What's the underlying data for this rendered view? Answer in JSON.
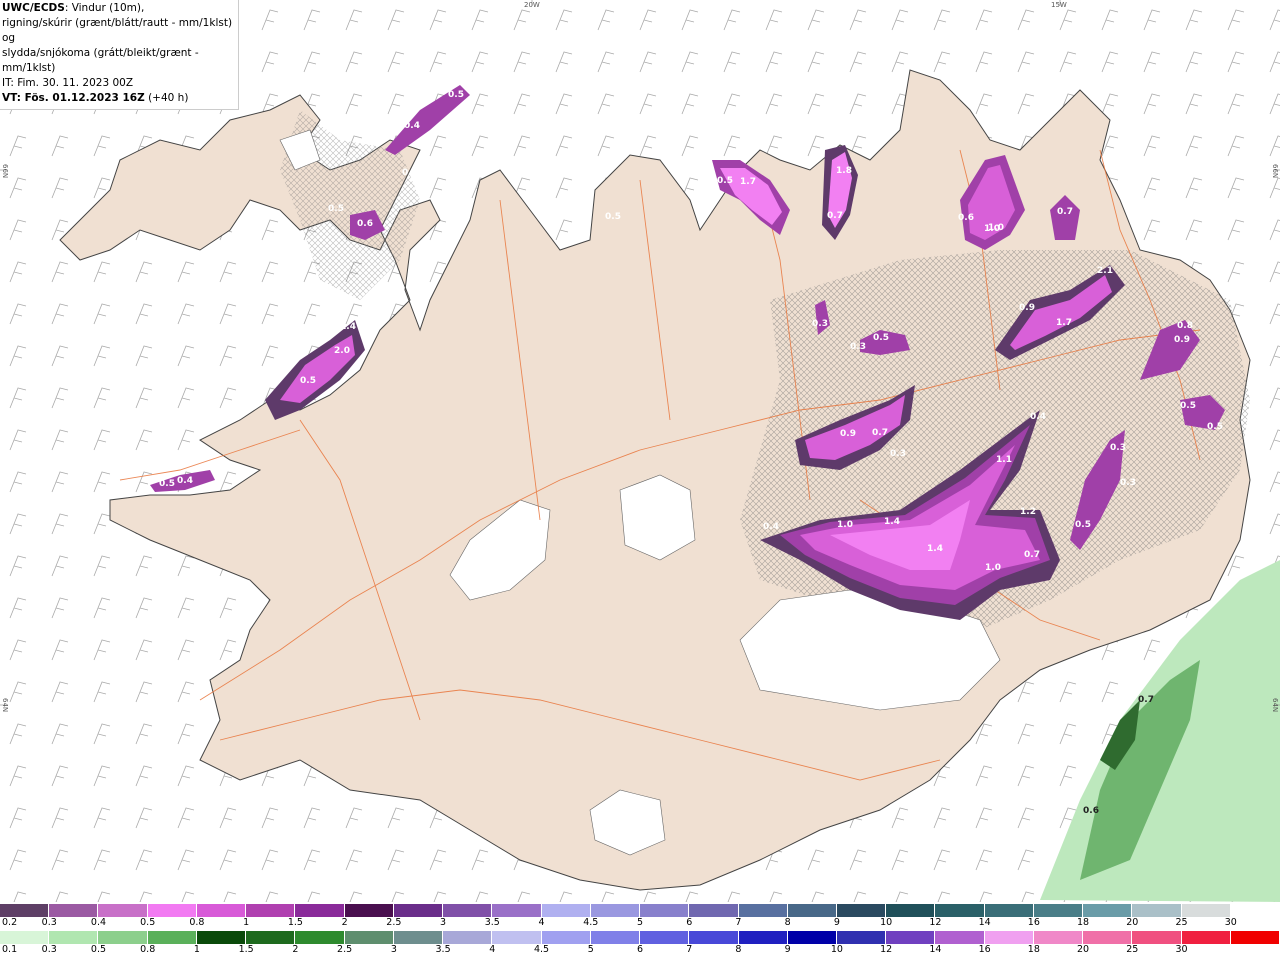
{
  "header": {
    "title": "UWC/ECDS",
    "description_line1": ": Vindur (10m),",
    "description_line2": "rigning/skúrir (grænt/blátt/rautt - mm/1klst) og",
    "description_line3": "slydda/snjókoma (grátt/bleikt/grænt - mm/1klst)",
    "init_time": "IT: Fim. 30. 11. 2023 00Z",
    "valid_label": "VT: Fös. 01.12.2023 16Z",
    "valid_offset": " (+40 h)"
  },
  "coords": {
    "lon_20w": "20W",
    "lon_15w": "15W",
    "lat_66n_left": "66N",
    "lat_66n_right": "66N",
    "lat_64n_left": "64N",
    "lat_64n_right": "64N"
  },
  "colors": {
    "land": "#f0e0d2",
    "glacier": "#ffffff",
    "roads": "#e8743a",
    "coast": "#444444",
    "snow_light": "#f280f2",
    "snow_mid": "#d860d8",
    "snow_dark": "#a040a8",
    "snow_darkest": "#5e3a6a",
    "rain_light": "#bde8bd",
    "rain_mid": "#6fb56f",
    "rain_dark": "#2f6b2f"
  },
  "map_labels": [
    {
      "text": "0.5"
    },
    {
      "text": "0.4"
    },
    {
      "text": "0.3"
    },
    {
      "text": "0.5"
    },
    {
      "text": "0.6"
    },
    {
      "text": "1.4"
    },
    {
      "text": "2.0"
    },
    {
      "text": "0.5"
    },
    {
      "text": "0.5"
    },
    {
      "text": "0.4"
    },
    {
      "text": "0.5"
    },
    {
      "text": "1.7"
    },
    {
      "text": "1.8"
    },
    {
      "text": "0.7"
    },
    {
      "text": "0.5"
    },
    {
      "text": "0.6"
    },
    {
      "text": "1.0"
    },
    {
      "text": "0.7"
    },
    {
      "text": "0.3"
    },
    {
      "text": "0.5"
    },
    {
      "text": "0.3"
    },
    {
      "text": "0.9"
    },
    {
      "text": "1.7"
    },
    {
      "text": "2.1"
    },
    {
      "text": "0.8"
    },
    {
      "text": "0.9"
    },
    {
      "text": "0.9"
    },
    {
      "text": "0.7"
    },
    {
      "text": "0.3"
    },
    {
      "text": "0.4"
    },
    {
      "text": "1.1"
    },
    {
      "text": "0.4"
    },
    {
      "text": "1.0"
    },
    {
      "text": "1.4"
    },
    {
      "text": "1.4"
    },
    {
      "text": "1.0"
    },
    {
      "text": "1.2"
    },
    {
      "text": "0.5"
    },
    {
      "text": "0.7"
    },
    {
      "text": "0.3"
    },
    {
      "text": "0.5"
    },
    {
      "text": "0.5"
    },
    {
      "text": "0.3"
    },
    {
      "text": "1.0"
    },
    {
      "text": "0.6"
    },
    {
      "text": "0.7"
    }
  ],
  "legend_snow": {
    "colors": [
      "#5e3f66",
      "#9b5aa3",
      "#c870c8",
      "#f27af2",
      "#d85ad8",
      "#b040b0",
      "#8a2a9a",
      "#4a0f4f",
      "#6a2d8a",
      "#8050a8",
      "#9a70c8",
      "#b0b0f0",
      "#9a98e0",
      "#8880cc",
      "#7068b0",
      "#5870a0",
      "#486888",
      "#2a4a60",
      "#20505a",
      "#2a6068",
      "#3a6e78",
      "#4a7e88",
      "#6a9ca8",
      "#aac0c8",
      "#d8dcdc",
      "#ffffff"
    ],
    "labels": [
      "0.2",
      "0.3",
      "0.4",
      "0.5",
      "0.8",
      "1",
      "1.5",
      "2",
      "2.5",
      "3",
      "3.5",
      "4",
      "4.5",
      "5",
      "6",
      "7",
      "8",
      "9",
      "10",
      "12",
      "14",
      "16",
      "18",
      "20",
      "25",
      "30"
    ]
  },
  "legend_rain": {
    "colors": [
      "#d8f5d8",
      "#b0e6b0",
      "#8ccf8c",
      "#5ab05a",
      "#0a4a0a",
      "#1e6a1e",
      "#2e8a2e",
      "#5e8e6e",
      "#6e8e8e",
      "#a8a8d8",
      "#c0c0f0",
      "#a0a0f0",
      "#8080e8",
      "#6060e0",
      "#4848d8",
      "#2020c0",
      "#0000a8",
      "#3030b0",
      "#7040c0",
      "#b060d0",
      "#f0a0f0",
      "#f088c8",
      "#f070a8",
      "#f05080",
      "#f02040",
      "#f00000"
    ],
    "labels": [
      "0.1",
      "0.3",
      "0.5",
      "0.8",
      "1",
      "1.5",
      "2",
      "2.5",
      "3",
      "3.5",
      "4",
      "4.5",
      "5",
      "6",
      "7",
      "8",
      "9",
      "10",
      "12",
      "14",
      "16",
      "18",
      "20",
      "25",
      "30"
    ]
  }
}
